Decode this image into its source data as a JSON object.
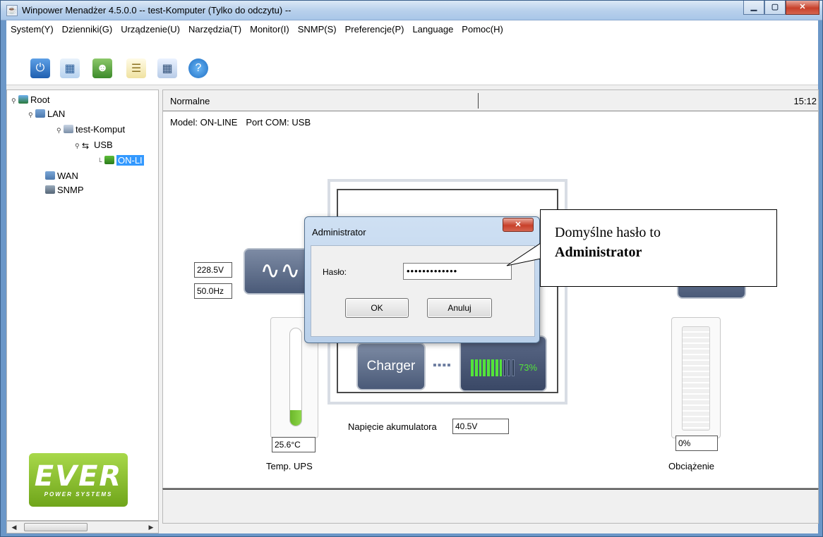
{
  "window": {
    "title": "Winpower Menadżer 4.5.0.0 -- test-Komputer (Tylko do odczytu) --"
  },
  "menu": [
    "System(Y)",
    "Dzienniki(G)",
    "Urządzenie(U)",
    "Narzędzia(T)",
    "Monitor(I)",
    "SNMP(S)",
    "Preferencje(P)",
    "Language",
    "Pomoc(H)"
  ],
  "tree": {
    "root": "Root",
    "lan": "LAN",
    "computer": "test-Komput",
    "usb": "USB",
    "device": "ON-LI",
    "wan": "WAN",
    "snmp": "SNMP"
  },
  "status": {
    "state": "Normalne",
    "time": "15:12"
  },
  "info": {
    "model": "Model: ON-LINE",
    "port": "Port COM: USB"
  },
  "input": {
    "voltage": "228.5V",
    "frequency": "50.0Hz"
  },
  "temperature": {
    "value": "25.6°C",
    "label": "Temp. UPS",
    "fill_percent": 16
  },
  "battery": {
    "charger_label": "Charger",
    "percent_text": "73%",
    "level": 0.73,
    "voltage_label": "Napięcie akumulatora",
    "voltage": "40.5V"
  },
  "load": {
    "value": "0%",
    "label": "Obciążenie"
  },
  "logo": {
    "main": "EVER",
    "sub": "POWER SYSTEMS"
  },
  "dialog": {
    "title": "Administrator",
    "password_label": "Hasło:",
    "password_value": "•••••••••••••",
    "ok_label": "OK",
    "cancel_label": "Anuluj"
  },
  "callout": {
    "line1": "Domyślne hasło to",
    "line2": "Administrator"
  },
  "colors": {
    "accent": "#3399ff",
    "battery_green": "#54e43a",
    "panel_gray": "#4a5a78"
  }
}
